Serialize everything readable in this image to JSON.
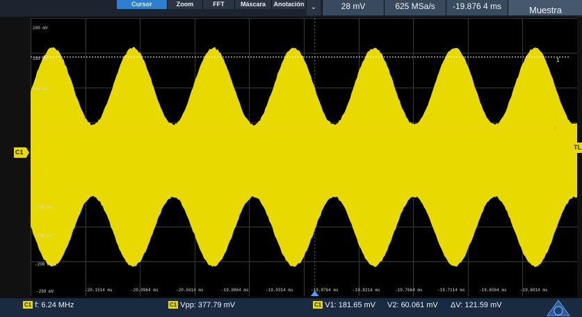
{
  "menu": {
    "items": [
      "Cursor",
      "Zoom",
      "FFT",
      "Máscara",
      "Anotación"
    ],
    "active_index": 0
  },
  "dropdown_glyph": "⌄",
  "readouts": {
    "vertical_scale": "28 mV",
    "sample_rate": "625 MSa/s",
    "time_position": "-19.876 4 ms",
    "acquisition_mode": "Muestra"
  },
  "channel": {
    "marker_label": "C1",
    "trigger_level_label": "TL",
    "color": "#e8d900"
  },
  "cursor_labels": {
    "cursor1": "1",
    "cursor2": "2"
  },
  "y_axis": [
    "200 mV",
    "150 mV",
    "100 mV",
    "-100 mV",
    "-150 mV",
    "-200 mV",
    "-250 mV"
  ],
  "x_axis": [
    "-20.1514 ms",
    "-20.0964 ms",
    "-20.0414 ms",
    "-19.9864 ms",
    "-19.9314 ms",
    "-19.8764 ms",
    "-19.8214 ms",
    "-19.7664 ms",
    "-19.7114 ms",
    "-19.6564 ms",
    "-19.6014 ms"
  ],
  "measurements": {
    "frequency": "f: 6.24 MHz",
    "vpp": "Vpp: 377.79 mV",
    "v1": "V1: 181.65 mV",
    "v2": "V2: 60.061 mV",
    "dv": "ΔV: 121.59 mV",
    "badge": "C1"
  },
  "colors": {
    "waveform": "#e8d900",
    "grid": "#3a3a3a",
    "menu_active": "#2f7fd0",
    "status_bar": "#1a2a40"
  }
}
